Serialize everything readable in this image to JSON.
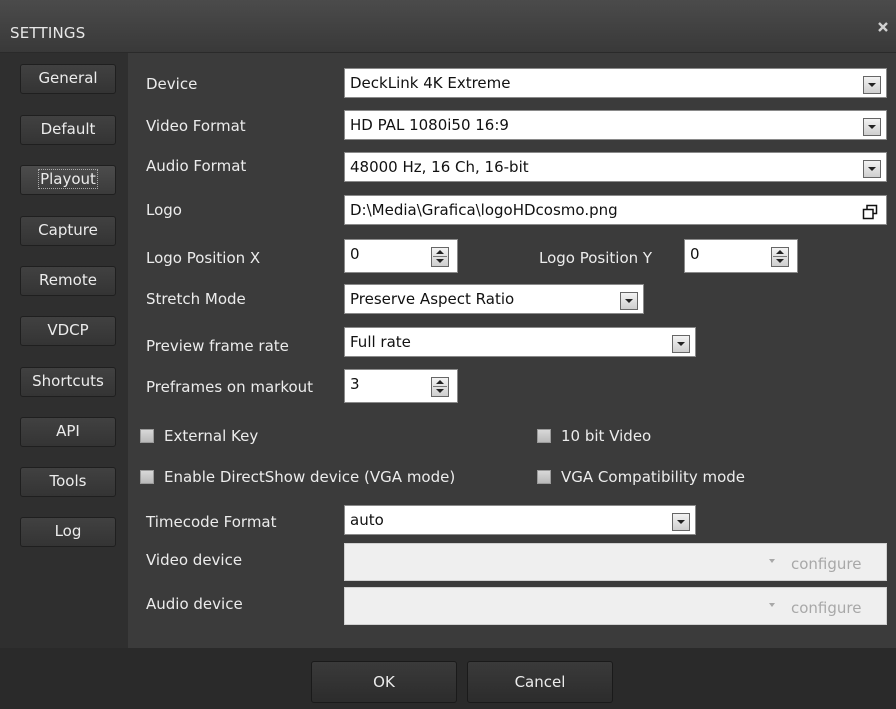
{
  "window": {
    "title": "SETTINGS",
    "close_icon": "close-icon"
  },
  "sidebar": {
    "items": [
      {
        "label": "General"
      },
      {
        "label": "Default"
      },
      {
        "label": "Playout",
        "active": true
      },
      {
        "label": "Capture"
      },
      {
        "label": "Remote"
      },
      {
        "label": "VDCP"
      },
      {
        "label": "Shortcuts"
      },
      {
        "label": "API"
      },
      {
        "label": "Tools"
      },
      {
        "label": "Log"
      }
    ]
  },
  "form": {
    "device": {
      "label": "Device",
      "value": "DeckLink 4K Extreme"
    },
    "video_format": {
      "label": "Video Format",
      "value": "HD PAL 1080i50 16:9"
    },
    "audio_format": {
      "label": "Audio Format",
      "value": "48000 Hz, 16 Ch, 16-bit"
    },
    "logo": {
      "label": "Logo",
      "value": "D:\\Media\\Grafica\\logoHDcosmo.png",
      "icon": "browse-icon"
    },
    "logo_pos_x": {
      "label": "Logo Position X",
      "value": "0"
    },
    "logo_pos_y": {
      "label": "Logo Position Y",
      "value": "0"
    },
    "stretch_mode": {
      "label": "Stretch Mode",
      "value": "Preserve Aspect Ratio"
    },
    "preview_frame_rate": {
      "label": "Preview frame rate",
      "value": "Full rate"
    },
    "preframes_on_markout": {
      "label": "Preframes on markout",
      "value": "3"
    },
    "external_key": {
      "label": "External Key",
      "checked": false
    },
    "ten_bit_video": {
      "label": "10 bit Video",
      "checked": false
    },
    "enable_directshow": {
      "label": "Enable DirectShow device (VGA mode)",
      "checked": false
    },
    "vga_compat": {
      "label": "VGA Compatibility mode",
      "checked": false
    },
    "timecode_format": {
      "label": "Timecode Format",
      "value": "auto"
    },
    "video_device": {
      "label": "Video device",
      "value": "",
      "configure": "configure",
      "disabled": true
    },
    "audio_device": {
      "label": "Audio device",
      "value": "",
      "configure": "configure",
      "disabled": true
    }
  },
  "footer": {
    "ok_label": "OK",
    "cancel_label": "Cancel"
  }
}
